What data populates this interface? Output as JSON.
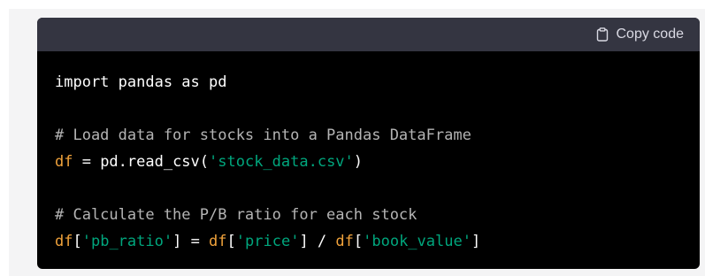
{
  "copy_button": {
    "label": "Copy code",
    "icon": "clipboard-icon"
  },
  "colors": {
    "header_bg": "#343541",
    "code_bg": "#000000",
    "comment": "#b4b4b4",
    "variable": "#f0a23b",
    "string": "#00a67d"
  },
  "code": {
    "lines": [
      [
        {
          "type": "plain",
          "text": "import pandas as pd"
        }
      ],
      [],
      [
        {
          "type": "comment",
          "text": "# Load data for stocks into a Pandas DataFrame"
        }
      ],
      [
        {
          "type": "var",
          "text": "df"
        },
        {
          "type": "plain",
          "text": " = pd.read_csv("
        },
        {
          "type": "string",
          "text": "'stock_data.csv'"
        },
        {
          "type": "plain",
          "text": ")"
        }
      ],
      [],
      [
        {
          "type": "comment",
          "text": "# Calculate the P/B ratio for each stock"
        }
      ],
      [
        {
          "type": "var",
          "text": "df"
        },
        {
          "type": "plain",
          "text": "["
        },
        {
          "type": "string",
          "text": "'pb_ratio'"
        },
        {
          "type": "plain",
          "text": "] = "
        },
        {
          "type": "var",
          "text": "df"
        },
        {
          "type": "plain",
          "text": "["
        },
        {
          "type": "string",
          "text": "'price'"
        },
        {
          "type": "plain",
          "text": "] / "
        },
        {
          "type": "var",
          "text": "df"
        },
        {
          "type": "plain",
          "text": "["
        },
        {
          "type": "string",
          "text": "'book_value'"
        },
        {
          "type": "plain",
          "text": "]"
        }
      ]
    ]
  }
}
